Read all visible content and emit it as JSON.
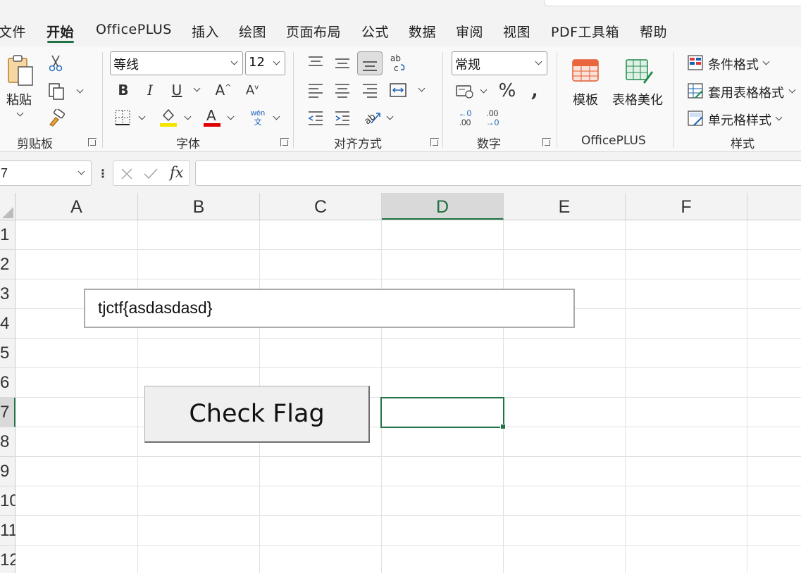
{
  "menu": {
    "tabs": [
      "文件",
      "开始",
      "OfficePLUS",
      "插入",
      "绘图",
      "页面布局",
      "公式",
      "数据",
      "审阅",
      "视图",
      "PDF工具箱",
      "帮助"
    ],
    "active_tab": "开始"
  },
  "ribbon": {
    "clipboard": {
      "paste_label": "粘贴",
      "group_label": "剪贴板"
    },
    "font": {
      "font_name": "等线",
      "font_size": "12",
      "group_label": "字体",
      "pinyin_top": "wén",
      "pinyin_bottom": "文",
      "highlight_color": "#f5e400",
      "font_color": "#e00000"
    },
    "alignment": {
      "group_label": "对齐方式"
    },
    "number": {
      "format": "常规",
      "group_label": "数字",
      "percent": "%",
      "comma": ",",
      "inc_decimal_top": "←0",
      "inc_decimal_bottom": ".00",
      "dec_decimal_top": ".00",
      "dec_decimal_bottom": "→0"
    },
    "officeplus": {
      "template_label": "模板",
      "beautify_label": "表格美化",
      "group_label": "OfficePLUS"
    },
    "styles": {
      "conditional_format": "条件格式",
      "table_format": "套用表格格式",
      "cell_styles": "单元格样式",
      "group_label": "样式"
    }
  },
  "formula_bar": {
    "name_box": "7",
    "fx_label": "fx",
    "formula": ""
  },
  "grid": {
    "columns": [
      "A",
      "B",
      "C",
      "D",
      "E",
      "F"
    ],
    "selected_column": "D",
    "rows": [
      "1",
      "2",
      "3",
      "4",
      "5",
      "6",
      "7",
      "8",
      "9",
      "10",
      "11",
      "12"
    ],
    "selected_row": "7"
  },
  "textbox": {
    "value": "tjctf{asdasdasd}"
  },
  "button": {
    "label": "Check Flag"
  },
  "colors": {
    "accent": "#217346"
  }
}
